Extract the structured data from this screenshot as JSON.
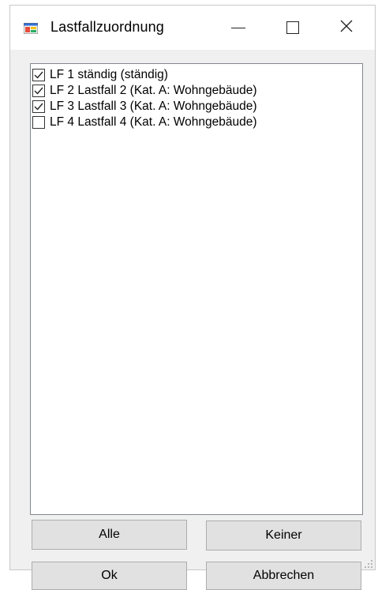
{
  "window": {
    "title": "Lastfallzuordnung",
    "icons": {
      "app": "app-window-icon",
      "minimize": "minimize-icon",
      "maximize": "maximize-icon",
      "close": "close-icon"
    }
  },
  "list": {
    "items": [
      {
        "label": "LF 1 ständig (ständig)",
        "checked": true
      },
      {
        "label": "LF 2 Lastfall 2 (Kat. A: Wohngebäude)",
        "checked": true
      },
      {
        "label": "LF 3 Lastfall 3 (Kat. A: Wohngebäude)",
        "checked": true
      },
      {
        "label": "LF 4 Lastfall 4 (Kat. A: Wohngebäude)",
        "checked": false
      }
    ]
  },
  "buttons": {
    "all": "Alle",
    "none": "Keiner",
    "ok": "Ok",
    "cancel": "Abbrechen"
  },
  "colors": {
    "window_bg": "#f0f0f0",
    "titlebar_bg": "#ffffff",
    "button_bg": "#e1e1e1",
    "button_border": "#adadad",
    "list_border": "#828790"
  }
}
